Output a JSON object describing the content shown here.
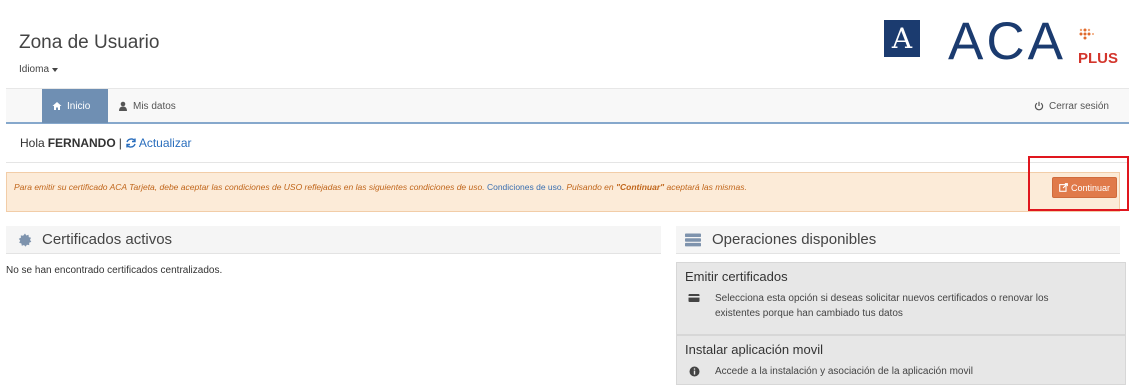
{
  "header": {
    "title": "Zona de Usuario",
    "language_label": "Idioma",
    "logo": {
      "mark": "A",
      "text": "ACA",
      "suffix": "PLUS"
    }
  },
  "nav": {
    "home_label": "Inicio",
    "profile_label": "Mis datos",
    "logout_label": "Cerrar sesión"
  },
  "greeting": {
    "prefix": "Hola",
    "user": "FERNANDO",
    "separator": "|",
    "refresh_label": "Actualizar"
  },
  "alert": {
    "text_before_link": "Para emitir su certificado ACA Tarjeta, debe aceptar las condiciones de USO reflejadas en las siguientes condiciones de uso. ",
    "link_label": "Condiciones de uso.",
    "text_after_link": " Pulsando en ",
    "emphasis": "\"Continuar\"",
    "text_end": " aceptará las mismas.",
    "button_label": "Continuar"
  },
  "panels": {
    "active": {
      "title": "Certificados activos",
      "empty_text": "No se han encontrado certificados centralizados."
    },
    "operations": {
      "title": "Operaciones disponibles",
      "items": [
        {
          "title": "Emitir certificados",
          "description": "Selecciona esta opción si deseas solicitar nuevos certificados o renovar los existentes porque han cambiado tus datos",
          "icon": "card-icon"
        },
        {
          "title": "Instalar aplicación movil",
          "description": "Accede a la instalación y asociación de la aplicación movil",
          "icon": "info-icon"
        }
      ]
    }
  },
  "colors": {
    "brand_blue": "#1b3b6f",
    "brand_red": "#d3352c",
    "nav_active": "#6f8fb3",
    "alert_bg": "#fcebd8",
    "alert_text": "#c0651a",
    "button_orange": "#e07a4a",
    "highlight_red": "#e0161e"
  }
}
